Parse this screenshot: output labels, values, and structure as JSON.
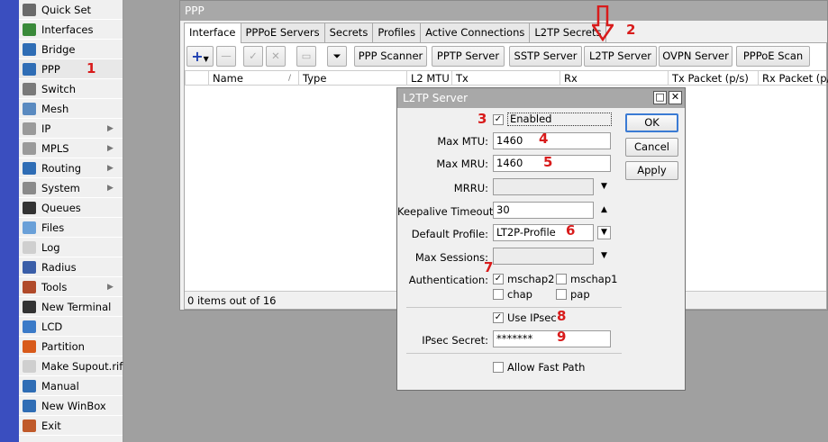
{
  "sidebar": {
    "items": [
      {
        "label": "Quick Set",
        "icon": "quick-set-icon",
        "color": "#6a6a6a"
      },
      {
        "label": "Interfaces",
        "icon": "interfaces-icon",
        "color": "#3a8a3a"
      },
      {
        "label": "Bridge",
        "icon": "bridge-icon",
        "color": "#2f6db5"
      },
      {
        "label": "PPP",
        "icon": "ppp-icon",
        "color": "#2f6db5"
      },
      {
        "label": "Switch",
        "icon": "switch-icon",
        "color": "#7a7a7a"
      },
      {
        "label": "Mesh",
        "icon": "mesh-icon",
        "color": "#5a8ac0"
      },
      {
        "label": "IP",
        "icon": "ip-icon",
        "color": "#9a9a9a",
        "has_submenu": true
      },
      {
        "label": "MPLS",
        "icon": "mpls-icon",
        "color": "#9a9a9a",
        "has_submenu": true
      },
      {
        "label": "Routing",
        "icon": "routing-icon",
        "color": "#2f6db5",
        "has_submenu": true
      },
      {
        "label": "System",
        "icon": "system-icon",
        "color": "#8a8a8a",
        "has_submenu": true
      },
      {
        "label": "Queues",
        "icon": "queues-icon",
        "color": "#333333"
      },
      {
        "label": "Files",
        "icon": "files-icon",
        "color": "#6aa0d8"
      },
      {
        "label": "Log",
        "icon": "log-icon",
        "color": "#cfcfcf"
      },
      {
        "label": "Radius",
        "icon": "radius-icon",
        "color": "#3a5ea8"
      },
      {
        "label": "Tools",
        "icon": "tools-icon",
        "color": "#b04a2a",
        "has_submenu": true
      },
      {
        "label": "New Terminal",
        "icon": "terminal-icon",
        "color": "#333333"
      },
      {
        "label": "LCD",
        "icon": "lcd-icon",
        "color": "#3a7ac8"
      },
      {
        "label": "Partition",
        "icon": "partition-icon",
        "color": "#d85a1a"
      },
      {
        "label": "Make Supout.rif",
        "icon": "supout-icon",
        "color": "#cfcfcf"
      },
      {
        "label": "Manual",
        "icon": "manual-icon",
        "color": "#2f6db5"
      },
      {
        "label": "New WinBox",
        "icon": "winbox-icon",
        "color": "#2f6db5"
      },
      {
        "label": "Exit",
        "icon": "exit-icon",
        "color": "#c05a2a"
      }
    ]
  },
  "ppp_window": {
    "title": "PPP",
    "tabs": [
      "Interface",
      "PPPoE Servers",
      "Secrets",
      "Profiles",
      "Active Connections",
      "L2TP Secrets"
    ],
    "toolbar": {
      "buttons": [
        "PPP Scanner",
        "PPTP Server",
        "SSTP Server",
        "L2TP Server",
        "OVPN Server",
        "PPPoE Scan"
      ]
    },
    "columns": [
      "Name",
      "Type",
      "L2 MTU",
      "Tx",
      "Rx",
      "Tx Packet (p/s)",
      "Rx Packet (p/s)"
    ],
    "status": "0 items out of 16"
  },
  "dialog": {
    "title": "L2TP Server",
    "enabled_label": "Enabled",
    "enabled": true,
    "max_mtu_label": "Max MTU:",
    "max_mtu": "1460",
    "max_mru_label": "Max MRU:",
    "max_mru": "1460",
    "mrru_label": "MRRU:",
    "mrru": "",
    "keepalive_label": "Keepalive Timeout:",
    "keepalive": "30",
    "default_profile_label": "Default Profile:",
    "default_profile": "LT2P-Profile",
    "max_sessions_label": "Max Sessions:",
    "max_sessions": "",
    "authentication_label": "Authentication:",
    "auth": [
      {
        "label": "mschap2",
        "checked": true
      },
      {
        "label": "mschap1",
        "checked": false
      },
      {
        "label": "chap",
        "checked": false
      },
      {
        "label": "pap",
        "checked": false
      }
    ],
    "use_ipsec_label": "Use IPsec",
    "use_ipsec": true,
    "ipsec_secret_label": "IPsec Secret:",
    "ipsec_secret": "*******",
    "allow_fast_path_label": "Allow Fast Path",
    "allow_fast_path": false,
    "ok_label": "OK",
    "cancel_label": "Cancel",
    "apply_label": "Apply"
  },
  "annotations": {
    "n1": "1",
    "n2": "2",
    "n3": "3",
    "n4": "4",
    "n5": "5",
    "n6": "6",
    "n7": "7",
    "n8": "8",
    "n9": "9",
    "color": "#d81b1b"
  },
  "colors": {
    "sidebar_stripe": "#3a4ebf",
    "window_title": "#a8a8a8",
    "ok_focus": "#3b7bd4"
  }
}
